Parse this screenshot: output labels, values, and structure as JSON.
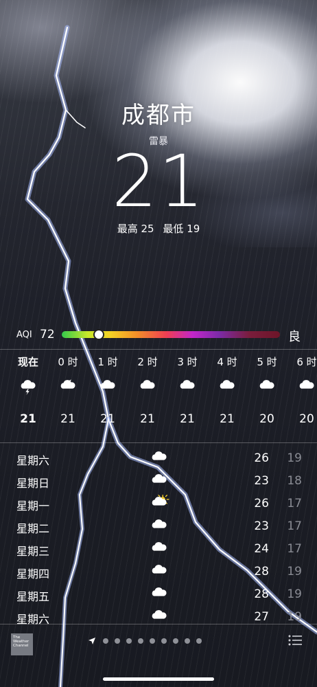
{
  "location": {
    "city": "成都市",
    "condition": "雷暴",
    "temperature": "21",
    "high": "最高 25",
    "low": "最低 19"
  },
  "aqi": {
    "label": "AQI",
    "value": "72",
    "level": "良",
    "bar_fraction": 0.17
  },
  "hourly": [
    {
      "time": "现在",
      "icon": "thunderstorm-icon",
      "temp": "21"
    },
    {
      "time": "0 时",
      "icon": "moon-cloud-icon",
      "temp": "21"
    },
    {
      "time": "1 时",
      "icon": "cloud-icon",
      "temp": "21"
    },
    {
      "time": "2 时",
      "icon": "cloud-icon",
      "temp": "21"
    },
    {
      "time": "3 时",
      "icon": "cloud-icon",
      "temp": "21"
    },
    {
      "time": "4 时",
      "icon": "cloud-icon",
      "temp": "21"
    },
    {
      "time": "5 时",
      "icon": "cloud-icon",
      "temp": "20"
    },
    {
      "time": "6 时",
      "icon": "cloud-icon",
      "temp": "20"
    }
  ],
  "daily": [
    {
      "day": "星期六",
      "icon": "cloud-icon",
      "high": "26",
      "low": "19"
    },
    {
      "day": "星期日",
      "icon": "cloud-icon",
      "high": "23",
      "low": "18"
    },
    {
      "day": "星期一",
      "icon": "sun-cloud-icon",
      "high": "26",
      "low": "17"
    },
    {
      "day": "星期二",
      "icon": "cloud-icon",
      "high": "23",
      "low": "17"
    },
    {
      "day": "星期三",
      "icon": "cloud-icon",
      "high": "24",
      "low": "17"
    },
    {
      "day": "星期四",
      "icon": "cloud-icon",
      "high": "28",
      "low": "19"
    },
    {
      "day": "星期五",
      "icon": "cloud-icon",
      "high": "28",
      "low": "19"
    },
    {
      "day": "星期六",
      "icon": "cloud-icon",
      "high": "27",
      "low": "19"
    }
  ],
  "footer": {
    "logo_lines": [
      "The",
      "Weather",
      "Channel"
    ],
    "page_dots": 9
  }
}
